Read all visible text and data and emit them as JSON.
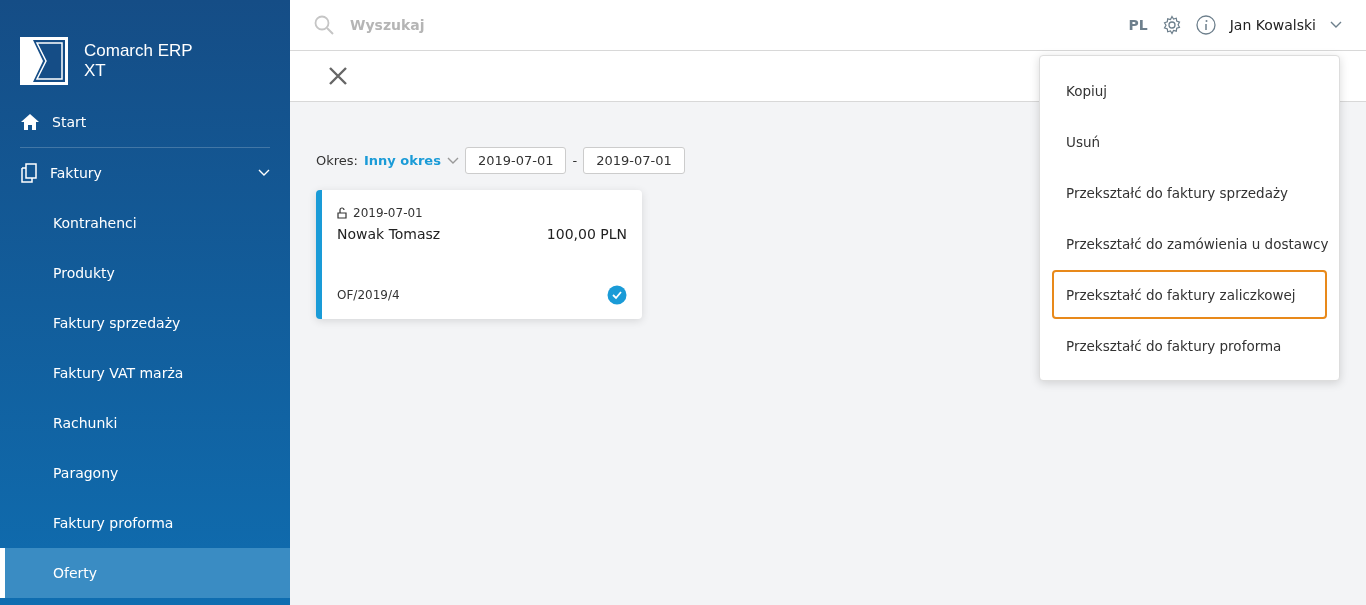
{
  "app": {
    "name_line1": "Comarch ERP",
    "name_line2": "XT"
  },
  "sidebar": {
    "items": [
      {
        "label": "Start",
        "kind": "home",
        "selected": false
      },
      {
        "label": "Faktury",
        "kind": "documents",
        "selected": false,
        "expanded": true,
        "children": [
          {
            "label": "Kontrahenci",
            "selected": false
          },
          {
            "label": "Produkty",
            "selected": false
          },
          {
            "label": "Faktury sprzedaży",
            "selected": false
          },
          {
            "label": "Faktury VAT marża",
            "selected": false
          },
          {
            "label": "Rachunki",
            "selected": false
          },
          {
            "label": "Paragony",
            "selected": false
          },
          {
            "label": "Faktury proforma",
            "selected": false
          },
          {
            "label": "Oferty",
            "selected": true
          }
        ]
      }
    ]
  },
  "topbar": {
    "search": {
      "placeholder": "Wyszukaj"
    },
    "language": "PL",
    "user": "Jan Kowalski"
  },
  "filter": {
    "label": "Okres:",
    "period": "Inny okres",
    "date_from": "2019-07-01",
    "separator": "-",
    "date_to": "2019-07-01"
  },
  "cards": [
    {
      "date": "2019-07-01",
      "customer": "Nowak Tomasz",
      "amount": "100,00 PLN",
      "number": "OF/2019/4",
      "checked": true
    }
  ],
  "menu": {
    "items": [
      {
        "label": "Kopiuj",
        "highlighted": false
      },
      {
        "label": "Usuń",
        "highlighted": false
      },
      {
        "label": "Przekształć do faktury sprzedaży",
        "highlighted": false
      },
      {
        "label": "Przekształć do zamówienia u dostawcy",
        "highlighted": false
      },
      {
        "label": "Przekształć do faktury zaliczkowej",
        "highlighted": true
      },
      {
        "label": "Przekształć do faktury proforma",
        "highlighted": false
      }
    ]
  }
}
